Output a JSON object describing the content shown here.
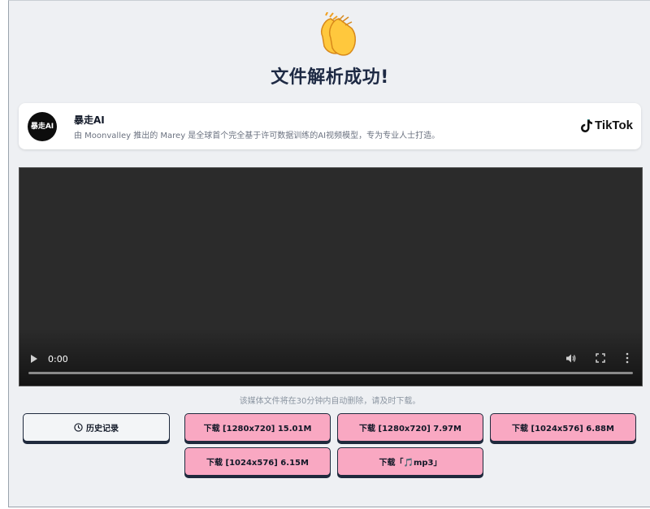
{
  "page": {
    "title": "文件解析成功!",
    "icon": "clapping-hands-icon"
  },
  "post": {
    "author": "暴走AI",
    "avatar_text": "暴走AI",
    "description": "由 Moonvalley 推出的 Marey 是全球首个完全基于许可数据训练的AI视频模型，专为专业人士打造。",
    "platform": "TikTok"
  },
  "player": {
    "time": "0:00",
    "progress": 0
  },
  "notice": "该媒体文件将在30分钟内自动删除，请及时下载。",
  "buttons": {
    "history": "历史记录",
    "downloads": [
      "下载 [1280x720] 15.01M",
      "下载 [1280x720] 7.97M",
      "下载 [1024x576] 6.88M",
      "下载 [1024x576] 6.15M",
      "下载「🎵mp3」"
    ]
  },
  "colors": {
    "download_button": "#f9a8c2",
    "title": "#1e2a44",
    "background": "#eef0f3"
  }
}
